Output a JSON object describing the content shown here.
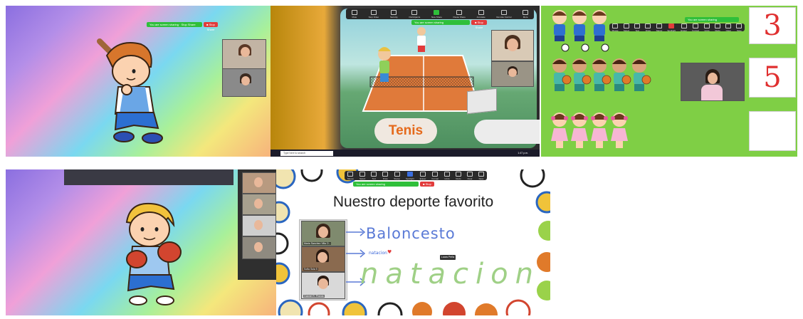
{
  "panel1": {
    "share_bar_text": "You are screen sharing · Stop Share",
    "stop_label": "■ Stop Share"
  },
  "panel2": {
    "toolbar_items": [
      "Mute",
      "Stop Video",
      "Security",
      "Participants",
      "New Share",
      "Pause Share",
      "Annotate",
      "Remote Control",
      "More"
    ],
    "share_bar_text": "You are screen sharing",
    "stop_label": "■ Stop Share",
    "sport_label": "Tenis",
    "search_placeholder": "Type here to search",
    "clock": "1:47 p.m."
  },
  "panel3": {
    "share_bar_text": "You are screen sharing",
    "toolbar_items": [
      "Mouse",
      "Select",
      "Text",
      "Draw",
      "Stamp",
      "Spotlight",
      "Eraser",
      "Format",
      "Undo",
      "Redo",
      "Clear",
      "Save"
    ],
    "counts": [
      "3",
      "5",
      ""
    ]
  },
  "panel5": {
    "toolbar_items": [
      "Mouse",
      "Select",
      "Text",
      "Draw",
      "Stamp",
      "Spotlight",
      "Eraser",
      "Format",
      "Undo",
      "Redo",
      "Clear",
      "Save"
    ],
    "share_bar_text": "You are screen sharing",
    "stop_label": "■ Stop Share",
    "title": "Nuestro deporte favorito",
    "participants": [
      {
        "name": "Maria Sanchez Villa O..."
      },
      {
        "name": "Sofia Sola 5"
      },
      {
        "name": "Gabriel R. Pineda"
      }
    ],
    "answers": {
      "baloncesto": "Baloncesto",
      "natacion": "natacion",
      "handwriting": "natacion",
      "stamp": "Lucas Peña"
    }
  },
  "colors": {
    "zoom_green": "#2fbf3a",
    "stop_red": "#e23b3b",
    "tenis_orange": "#e56a1c",
    "number_red": "#e03030",
    "court_orange": "#e07a3a",
    "field_green": "#7fcf45"
  }
}
